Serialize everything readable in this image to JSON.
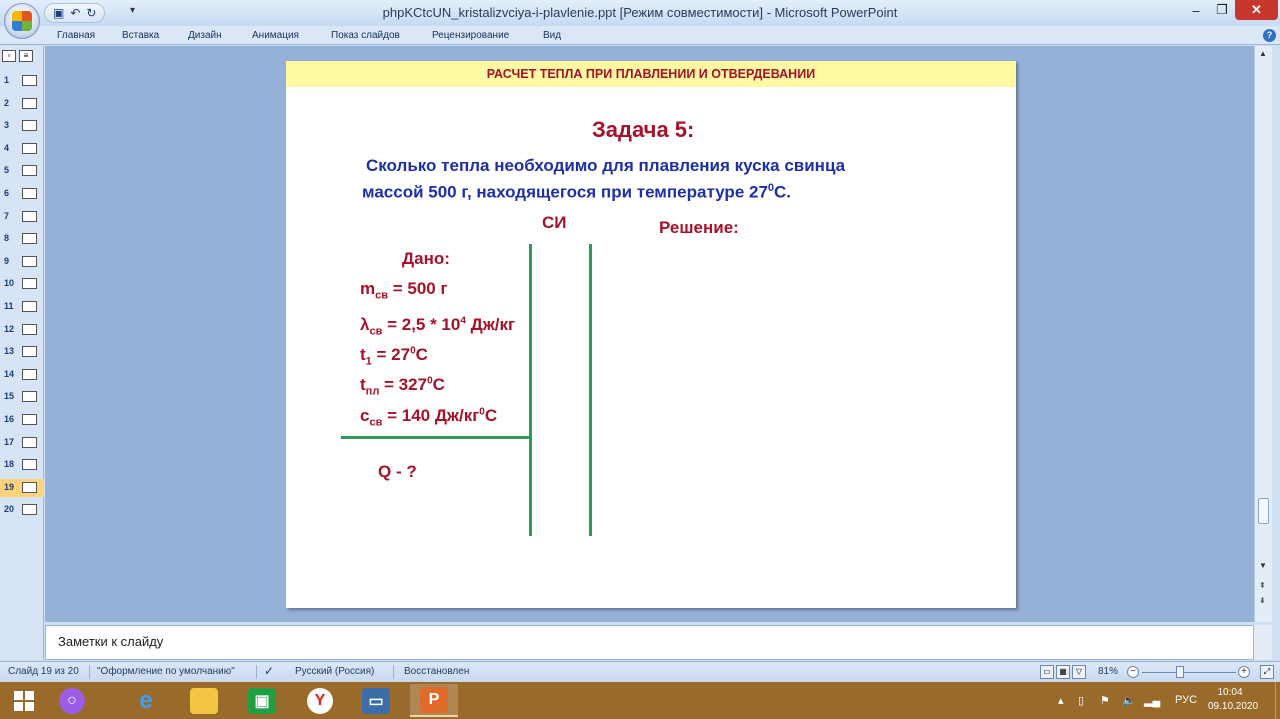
{
  "window": {
    "title": "phpKCtcUN_kristalizvciya-i-plavlenie.ppt [Режим совместимости] - Microsoft PowerPoint",
    "minimize_glyph": "–",
    "maximize_glyph": "❐",
    "close_glyph": "✕"
  },
  "ribbon": {
    "tabs": [
      "Главная",
      "Вставка",
      "Дизайн",
      "Анимация",
      "Показ слайдов",
      "Рецензирование",
      "Вид"
    ],
    "help_glyph": "?"
  },
  "slides_pane": {
    "numbers": [
      "1",
      "2",
      "3",
      "4",
      "5",
      "6",
      "7",
      "8",
      "9",
      "10",
      "11",
      "12",
      "13",
      "14",
      "15",
      "16",
      "17",
      "18",
      "19",
      "20"
    ],
    "active_index": 19
  },
  "slide": {
    "header": "РАСЧЕТ ТЕПЛА ПРИ ПЛАВЛЕНИИ И ОТВЕРДЕВАНИИ",
    "task_title": "Задача 5:",
    "question_line1": "Сколько тепла необходимо для плавления куска свинца",
    "question_line2_a": "массой 500 г, находящегося при температуре 27",
    "question_line2_sup": "0",
    "question_line2_b": "С.",
    "si_label": "СИ",
    "solution_label": "Решение:",
    "given_label": "Дано:",
    "given": {
      "m": {
        "sym": "m",
        "sub": "св",
        "rest": " = 500 г"
      },
      "lambda": {
        "sym": "λ",
        "sub": "св",
        "mid": " = 2,5 * 10",
        "sup": "4",
        "rest": " Дж/кг"
      },
      "t1": {
        "sym": "t",
        "sub": "1",
        "mid": " = 27",
        "sup": "0",
        "rest": "С"
      },
      "tpl": {
        "sym": "t",
        "sub": "пл",
        "mid": " = 327",
        "sup": "0",
        "rest": "С"
      },
      "c": {
        "sym": "c",
        "sub": "св",
        "mid": " = 140 Дж/кг",
        "sup": "0",
        "rest": "С"
      }
    },
    "find_label": "Q - ?"
  },
  "notes": {
    "placeholder": "Заметки к слайду"
  },
  "status": {
    "slide_info": "Слайд 19 из 20",
    "theme": "\"Оформление по умолчанию\"",
    "language": "Русский (Россия)",
    "state": "Восстановлен",
    "zoom": "81%",
    "zoom_minus": "−",
    "zoom_plus": "+"
  },
  "taskbar": {
    "tray_lang": "РУС",
    "clock_time": "10:04",
    "clock_date": "09.10.2020"
  },
  "colors": {
    "header_bg": "#fff9a3",
    "accent_red": "#a5122a",
    "accent_blue": "#1f2fa8",
    "line_green": "#2e9a57",
    "taskbar_bg": "#9a6a2a"
  }
}
